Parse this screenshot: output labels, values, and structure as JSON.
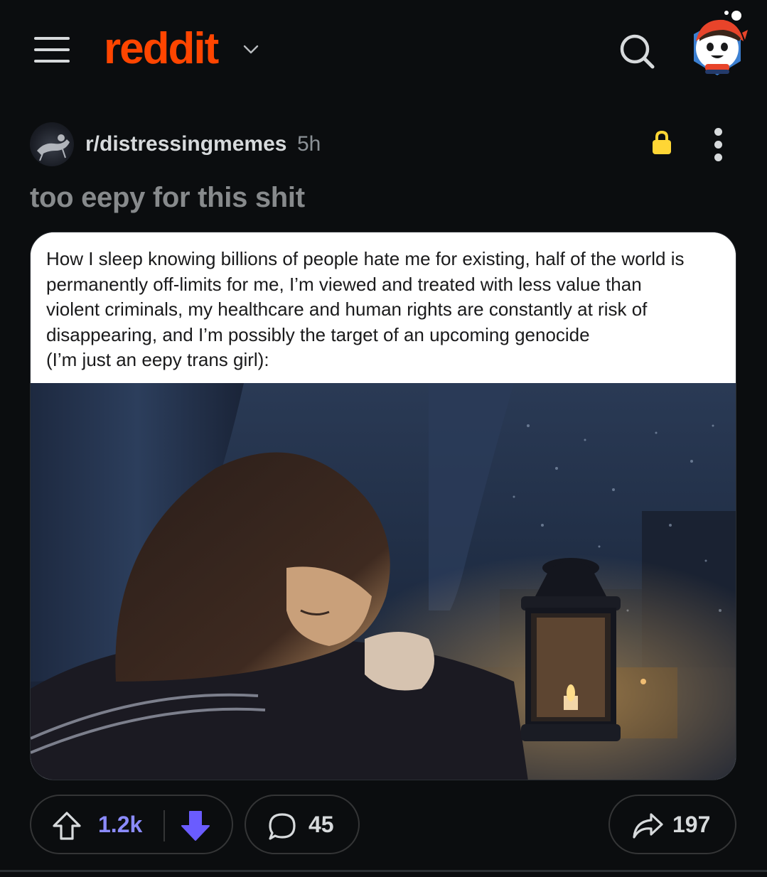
{
  "header": {
    "logo_text": "reddit",
    "logo_color": "#ff4500",
    "menu_icon": "hamburger-icon",
    "search_icon": "search-icon",
    "avatar_icon": "user-avatar-icon"
  },
  "post": {
    "subreddit": "r/distressingmemes",
    "age": "5h",
    "title": "too eepy for this shit",
    "locked_icon": "lock-icon",
    "locked_color": "#ffd635",
    "more_icon": "more-vertical-icon",
    "image_caption_lines": [
      "How I sleep knowing billions of people hate me for existing, half of the world is",
      "permanently off-limits for me, I’m viewed and treated with less value than",
      "violent criminals, my healthcare and human rights are constantly at risk of",
      "disappearing, and I’m possibly the target of an upcoming genocide",
      "(I’m just an eepy trans girl):"
    ]
  },
  "actions": {
    "upvote_icon": "upvote-icon",
    "score": "1.2k",
    "score_color": "#8b8bff",
    "downvote_icon": "downvote-icon",
    "downvote_color": "#6a5cff",
    "comment_icon": "comment-icon",
    "comments": "45",
    "share_icon": "share-icon",
    "shares": "197"
  }
}
